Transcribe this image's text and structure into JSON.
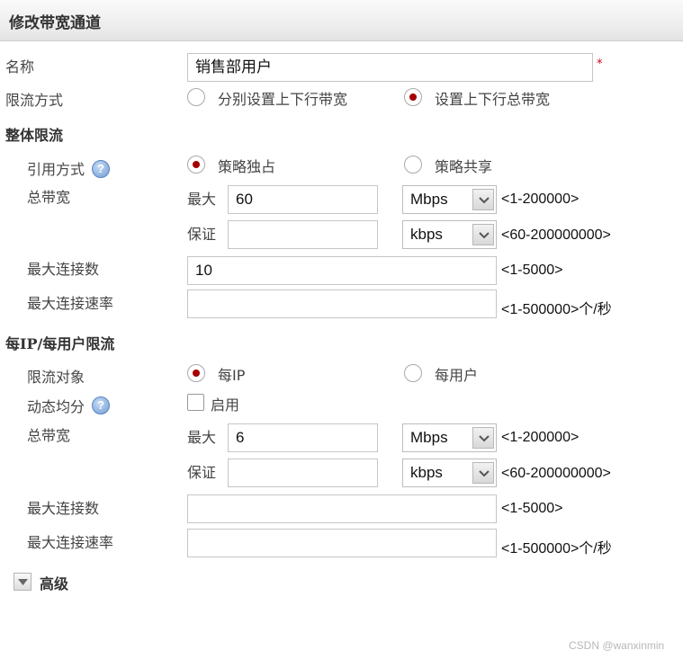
{
  "window": {
    "title": "修改带宽通道"
  },
  "name_row": {
    "label": "名称",
    "value": "销售部用户",
    "required_mark": "*"
  },
  "limit_mode": {
    "label": "限流方式",
    "options": [
      "分别设置上下行带宽",
      "设置上下行总带宽"
    ],
    "selected": 1
  },
  "overall": {
    "heading": "整体限流",
    "ref_mode": {
      "label": "引用方式",
      "options": [
        "策略独占",
        "策略共享"
      ],
      "selected": 0
    },
    "total_bw": {
      "label": "总带宽",
      "max": {
        "label": "最大",
        "value": "60",
        "unit": "Mbps",
        "range": "<1-200000>"
      },
      "guarantee": {
        "label": "保证",
        "value": "",
        "unit": "kbps",
        "range": "<60-200000000>"
      }
    },
    "max_conn": {
      "label": "最大连接数",
      "value": "10",
      "range": "<1-5000>"
    },
    "max_conn_rate": {
      "label": "最大连接速率",
      "value": "",
      "range": "<1-500000>个/秒"
    }
  },
  "per_ip": {
    "heading": "每IP/每用户限流",
    "target": {
      "label": "限流对象",
      "options": [
        "每IP",
        "每用户"
      ],
      "selected": 0
    },
    "dynamic": {
      "label": "动态均分",
      "checkbox_label": "启用",
      "checked": false
    },
    "total_bw": {
      "label": "总带宽",
      "max": {
        "label": "最大",
        "value": "6",
        "unit": "Mbps",
        "range": "<1-200000>"
      },
      "guarantee": {
        "label": "保证",
        "value": "",
        "unit": "kbps",
        "range": "<60-200000000>"
      }
    },
    "max_conn": {
      "label": "最大连接数",
      "value": "",
      "range": "<1-5000>"
    },
    "max_conn_rate": {
      "label": "最大连接速率",
      "value": "",
      "range": "<1-500000>个/秒"
    }
  },
  "advanced": {
    "label": "高级"
  },
  "help_glyph": "?",
  "icons": {
    "help": "help-icon",
    "dropdown": "chevron-down-icon",
    "expand": "triangle-down-icon"
  },
  "colors": {
    "radio_dot": "#a40000",
    "required": "#d0021b",
    "help": "#6f9bd4"
  },
  "watermark": "CSDN @wanxinmin"
}
